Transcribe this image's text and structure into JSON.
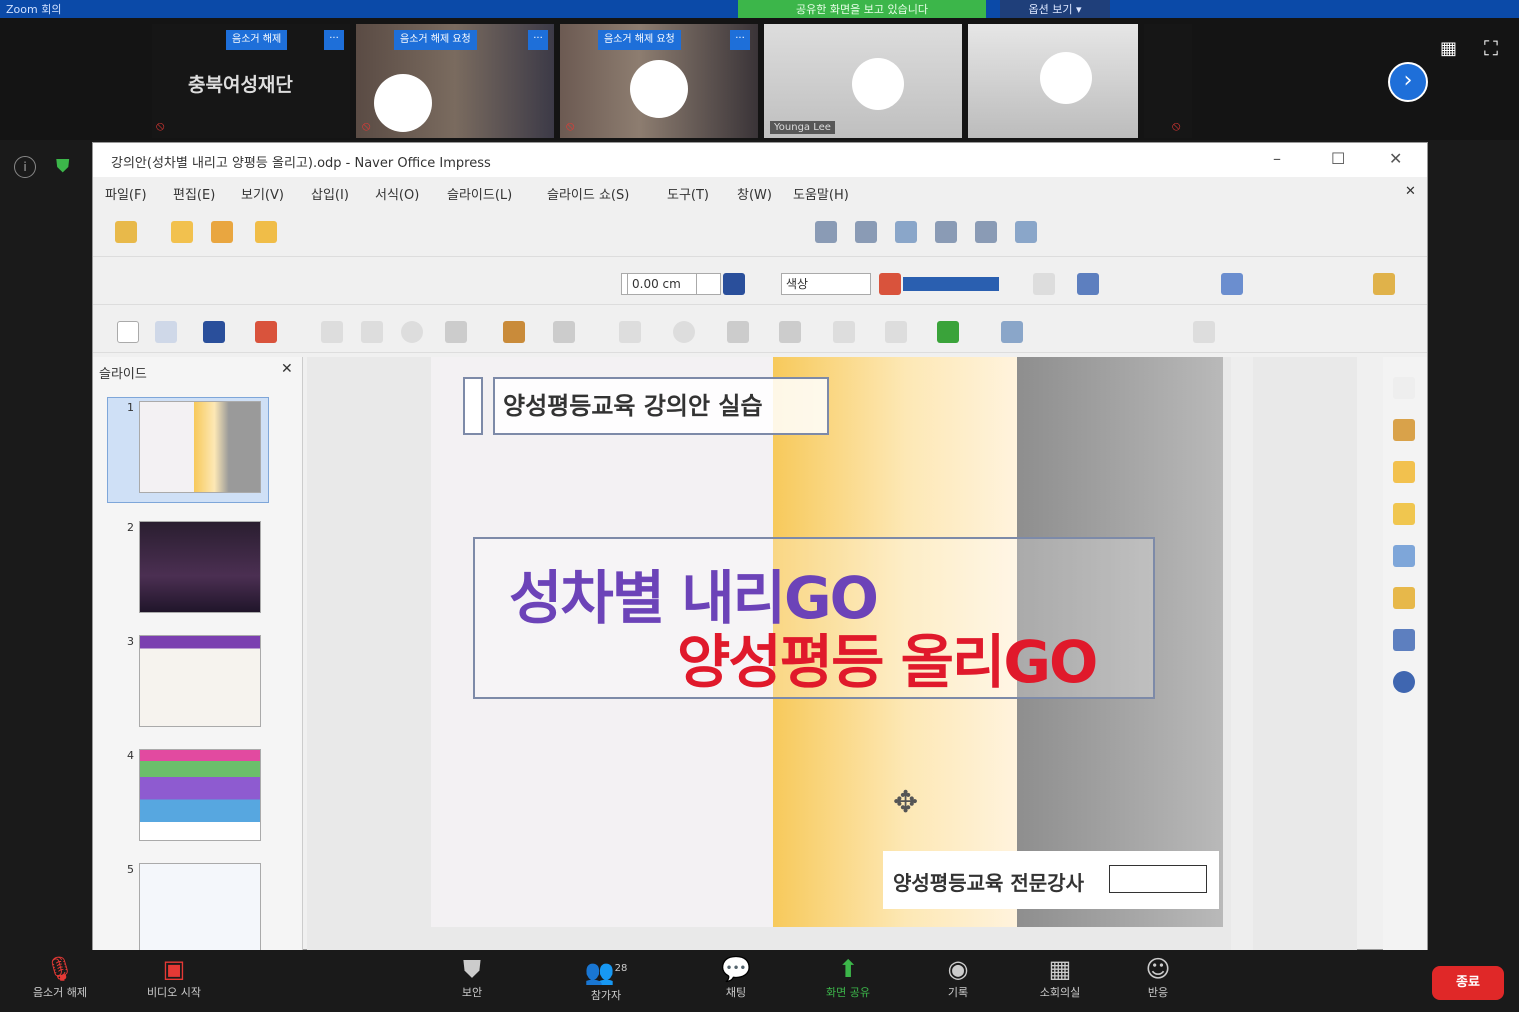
{
  "zoom": {
    "window_title": "Zoom 회의",
    "share_banner": "공유한 화면을 보고 있습니다",
    "view_options": "옵션 보기 ▾",
    "participants": [
      {
        "name": "음소거 해제",
        "org": "충북여성재단"
      },
      {
        "name": "음소거 해제 요청",
        "label": ""
      },
      {
        "name": "음소거 해제 요청",
        "label": ""
      },
      {
        "name": "",
        "label": "Younga Lee"
      },
      {
        "name": "",
        "label": ""
      }
    ],
    "controls": [
      {
        "icon": "mic-off-icon",
        "label": "음소거 해제"
      },
      {
        "icon": "video-off-icon",
        "label": "비디오 시작"
      },
      {
        "icon": "shield-icon",
        "label": "보안"
      },
      {
        "icon": "participants-icon",
        "label": "참가자",
        "count": "28"
      },
      {
        "icon": "chat-icon",
        "label": "채팅"
      },
      {
        "icon": "share-screen-icon",
        "label": "화면 공유"
      },
      {
        "icon": "record-icon",
        "label": "기록"
      },
      {
        "icon": "apps-icon",
        "label": "소회의실"
      },
      {
        "icon": "reactions-icon",
        "label": "반응"
      }
    ],
    "end_button": "종료"
  },
  "app": {
    "title": "강의안(성차별 내리고 양평등 올리고).odp - Naver Office Impress",
    "menu": [
      "파일(F)",
      "편집(E)",
      "보기(V)",
      "삽입(I)",
      "서식(O)",
      "슬라이드(L)",
      "슬라이드 쇼(S)",
      "도구(T)",
      "창(W)",
      "도움말(H)"
    ],
    "line_width": "0.00 cm",
    "line_color": "색상",
    "panel_title": "슬라이드",
    "thumbnails": [
      "1",
      "2",
      "3",
      "4",
      "5"
    ]
  },
  "slide": {
    "head": "양성평등교육 강의안 실습",
    "title_line1": "성차별 내리GO",
    "title_line2": "양성평등 올리GO",
    "footer": "양성평등교육 전문강사"
  },
  "colors": {
    "zoom_blue": "#1e6fd9",
    "share_green": "#3cb64a",
    "title_purple": "#6c43b8",
    "title_red": "#e0192b",
    "end_red": "#e02828"
  }
}
